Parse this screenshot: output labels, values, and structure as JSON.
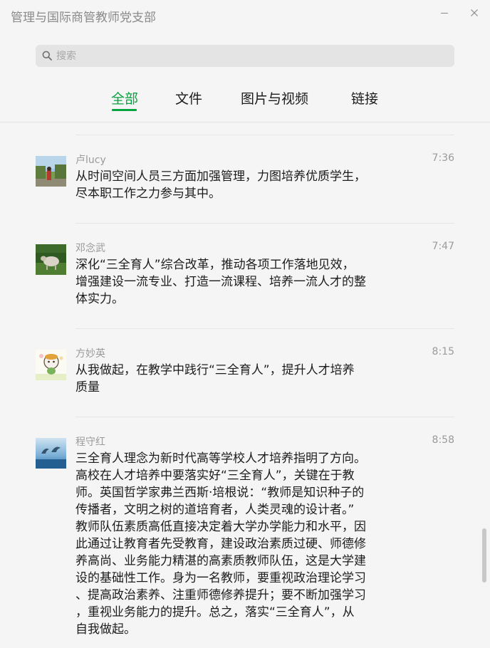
{
  "window": {
    "title": "管理与国际商管教师党支部"
  },
  "search": {
    "placeholder": "搜索"
  },
  "tabs": [
    {
      "label": "全部",
      "active": true
    },
    {
      "label": "文件",
      "active": false
    },
    {
      "label": "图片与视频",
      "active": false
    },
    {
      "label": "链接",
      "active": false
    }
  ],
  "messages": [
    {
      "sender": "卢lucy",
      "time": "7:36",
      "text": "从时间空间人员三方面加强管理，力图培养优质学生，\n尽本职工作之力参与其中。",
      "avatar": "person-on-path-photo"
    },
    {
      "sender": "邓念武",
      "time": "7:47",
      "text": "深化“三全育人”综合改革，推动各项工作落地见效，\n增强建设一流专业、打造一流课程、培养一流人才的整\n体实力。",
      "avatar": "sheep-on-grass-photo"
    },
    {
      "sender": "方妙英",
      "time": "8:15",
      "text": "从我做起，在教学中践行“三全育人”，提升人才培养\n质量",
      "avatar": "cartoon-character"
    },
    {
      "sender": "程守红",
      "time": "8:58",
      "text": "三全育人理念为新时代高等学校人才培养指明了方向。\n高校在人才培养中要落实好“三全育人”，关键在于教\n师。英国哲学家弗兰西斯·培根说：“教师是知识种子的\n传播者，文明之树的道培育者，人类灵魂的设计者。”\n教师队伍素质高低直接决定着大学办学能力和水平，因\n此通过让教育者先受教育，建设政治素质过硬、师德修\n养高尚、业务能力精湛的高素质教师队伍，这是大学建\n设的基础性工作。身为一名教师，要重视政治理论学习\n、提高政治素养、注重师德修养提升；要不断加强学习\n，重视业务能力的提升。总之，落实“三全育人”，从\n自我做起。",
      "avatar": "dolphins-photo"
    }
  ],
  "colors": {
    "accent": "#07a33f",
    "background": "#f5f5f5",
    "secondary_text": "#9a9a9a"
  }
}
